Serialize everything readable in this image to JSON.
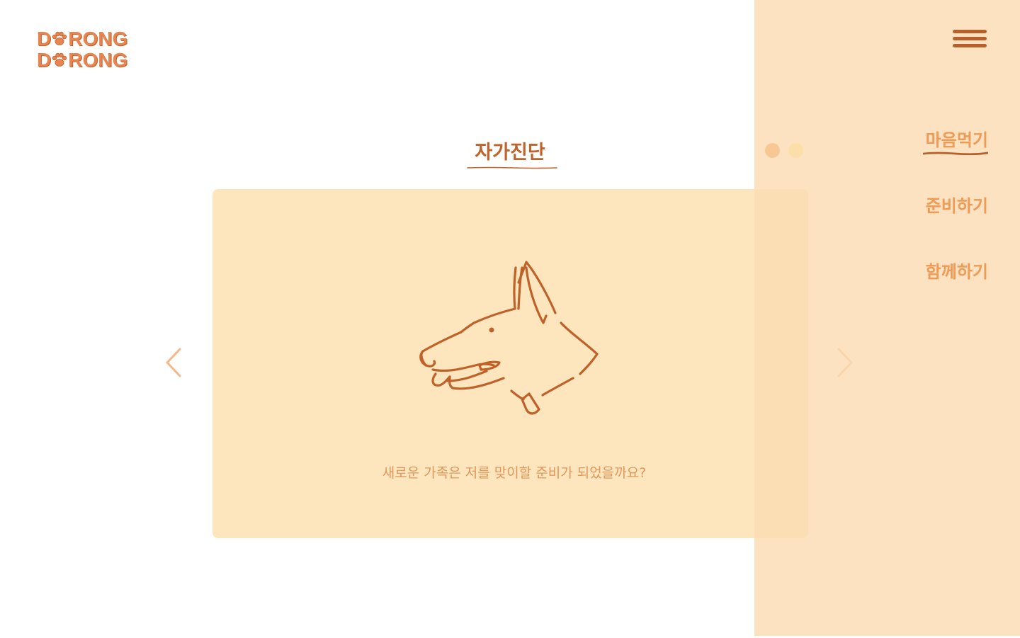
{
  "logo": {
    "line1_prefix": "D",
    "line1_suffix": "RONG",
    "line2_prefix": "D",
    "line2_suffix": "RONG"
  },
  "page_title": "자가진단",
  "card": {
    "question": "새로운 가족은 저를 맞이할 준비가 되었을까요?"
  },
  "menu": {
    "items": [
      {
        "label": "마음먹기",
        "active": true
      },
      {
        "label": "준비하기",
        "active": false
      },
      {
        "label": "함께하기",
        "active": false
      }
    ]
  },
  "icons": {
    "hamburger": "menu-icon",
    "left": "chevron-left-icon",
    "right": "chevron-right-icon",
    "paw": "paw-icon",
    "dog": "dog-head-illustration"
  },
  "colors": {
    "brand": "#c0622a",
    "accent": "#ef9a55",
    "card_bg": "#fde6bd",
    "panel_bg": "#fbdcb2"
  }
}
